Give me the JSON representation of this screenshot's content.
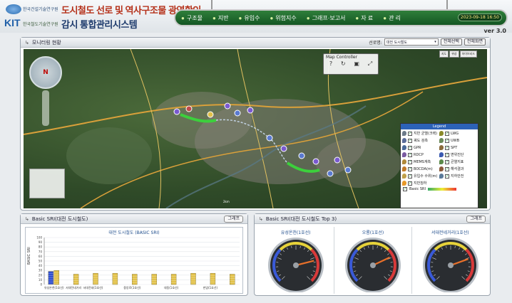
{
  "header": {
    "org_line1": "한국건설기술연구원",
    "org_line2": "한국철도기술연구원",
    "logo_text": "KIT",
    "title_line1": "도시철도 선로 및 역사구조물 광역확인",
    "title_line2": "감시 통합관리시스템",
    "version": "ver 3.0"
  },
  "menu": {
    "items": [
      {
        "label": "구조물"
      },
      {
        "label": "지반"
      },
      {
        "label": "유입수"
      },
      {
        "label": "위험지수"
      },
      {
        "label": "그래프·보고서"
      },
      {
        "label": "자 료"
      },
      {
        "label": "관 리"
      }
    ],
    "badge": "2023-09-18 16:50"
  },
  "monitor": {
    "title": "모니터링 현황",
    "line_label": "선로명:",
    "line_value": "대전 도시철도",
    "btn_select_all": "전체선택",
    "btn_fullscreen": "전체화면",
    "map_controller_title": "Map Controller",
    "map_toggle": [
      "지도",
      "위성",
      "하이브리드"
    ],
    "legend_title": "Legend",
    "legend_items": [
      {
        "label": "지반 균열(크랙)",
        "color": "#6c7a8a"
      },
      {
        "label": "LWG",
        "color": "#8a8a2a"
      },
      {
        "label": "궤도 검측",
        "color": "#5a6c9a"
      },
      {
        "label": "UWB",
        "color": "#6a8a5a"
      },
      {
        "label": "GPR",
        "color": "#4a6a9a"
      },
      {
        "label": "SPT",
        "color": "#8a6a3a"
      },
      {
        "label": "RDCP",
        "color": "#7a5aa0"
      },
      {
        "label": "변위진단",
        "color": "#3a5ab0"
      },
      {
        "label": "MEMS계측",
        "color": "#b08a3a"
      },
      {
        "label": "균열지표",
        "color": "#5a8a4a"
      },
      {
        "label": "BOCDA(m)",
        "color": "#c07a2a"
      },
      {
        "label": "해석결과",
        "color": "#8a5a3a"
      },
      {
        "label": "유입수 수위(m)",
        "color": "#c0a04a"
      },
      {
        "label": "지하안전",
        "color": "#5a7a9a"
      },
      {
        "label": "지반침하",
        "color": "#e89a2a"
      }
    ],
    "legend_foot": "Basic SRI",
    "scale_text": "2km"
  },
  "basic_sri": {
    "title": "Basic SRI(대전 도시철도)",
    "btn": "그래프",
    "chart_title": "대전 도시철도 (BASIC SRI)"
  },
  "top3": {
    "title": "Basic SRI(대전 도시철도 Top 3)",
    "btn": "그래프",
    "gauges": [
      {
        "name": "유성온천(1호선)",
        "value": 78
      },
      {
        "name": "오룡(1호선)",
        "value": 74
      },
      {
        "name": "서대전네거리(1호선)",
        "value": 76
      }
    ]
  },
  "chart_data": {
    "type": "bar",
    "title": "대전 도시철도 (BASIC SRI)",
    "ylabel": "BASIC SRI",
    "ylim": [
      0,
      100
    ],
    "yticks": [
      0,
      10,
      20,
      30,
      40,
      50,
      60,
      70,
      80,
      90,
      100
    ],
    "categories": [
      "유성온천(1호선)",
      "",
      "서대전네(1호선)",
      "",
      "중앙로(1호선)",
      "",
      "대동(1호선)",
      "",
      "판암(1호선)",
      ""
    ],
    "tick_labels": [
      "유성온천(1호선)",
      "서대전네거리",
      "서대전네(1호선)",
      "",
      "중앙로(1호선)",
      "",
      "대동(1호선)",
      "",
      "판암(1호선)",
      ""
    ],
    "series": [
      {
        "values": [
          28,
          0,
          0,
          0,
          0,
          0,
          0,
          0,
          0,
          0
        ],
        "color": "#2f4fd0"
      },
      {
        "values": [
          30,
          22,
          24,
          24,
          22,
          22,
          22,
          24,
          24,
          22
        ],
        "color": "#e2c24a"
      }
    ]
  }
}
